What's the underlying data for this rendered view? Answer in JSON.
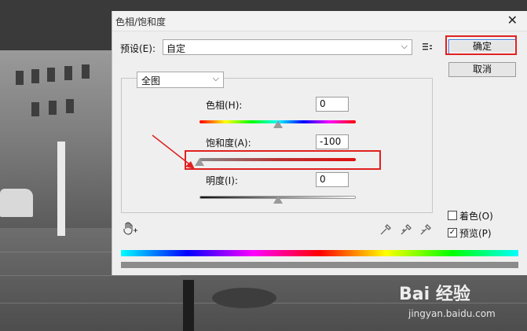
{
  "dialog": {
    "title": "色相/饱和度",
    "close_glyph": "✕",
    "preset_label": "预设(E):",
    "preset_value": "自定",
    "ok_label": "确定",
    "cancel_label": "取消",
    "range_value": "全图",
    "hue": {
      "label": "色相(H):",
      "value": "0",
      "level_percent": 50
    },
    "saturation": {
      "label": "饱和度(A):",
      "value": "-100",
      "level_percent": 0
    },
    "lightness": {
      "label": "明度(I):",
      "value": "0",
      "level_percent": 50
    },
    "colorize": {
      "label": "着色(O)",
      "checked": false
    },
    "preview": {
      "label": "预览(P)",
      "checked": true
    }
  },
  "icons": {
    "dropdown": "chevron-down-icon",
    "preset_menu": "list-menu-icon",
    "target_adjust": "hand-target-icon",
    "eyedroppers": [
      "eyedropper-icon",
      "eyedropper-plus-icon",
      "eyedropper-minus-icon"
    ]
  },
  "annotations": {
    "highlight_color": "#e02020"
  },
  "watermark": {
    "logo": "Bai 经验",
    "sub": "jingyan.baidu.com"
  }
}
